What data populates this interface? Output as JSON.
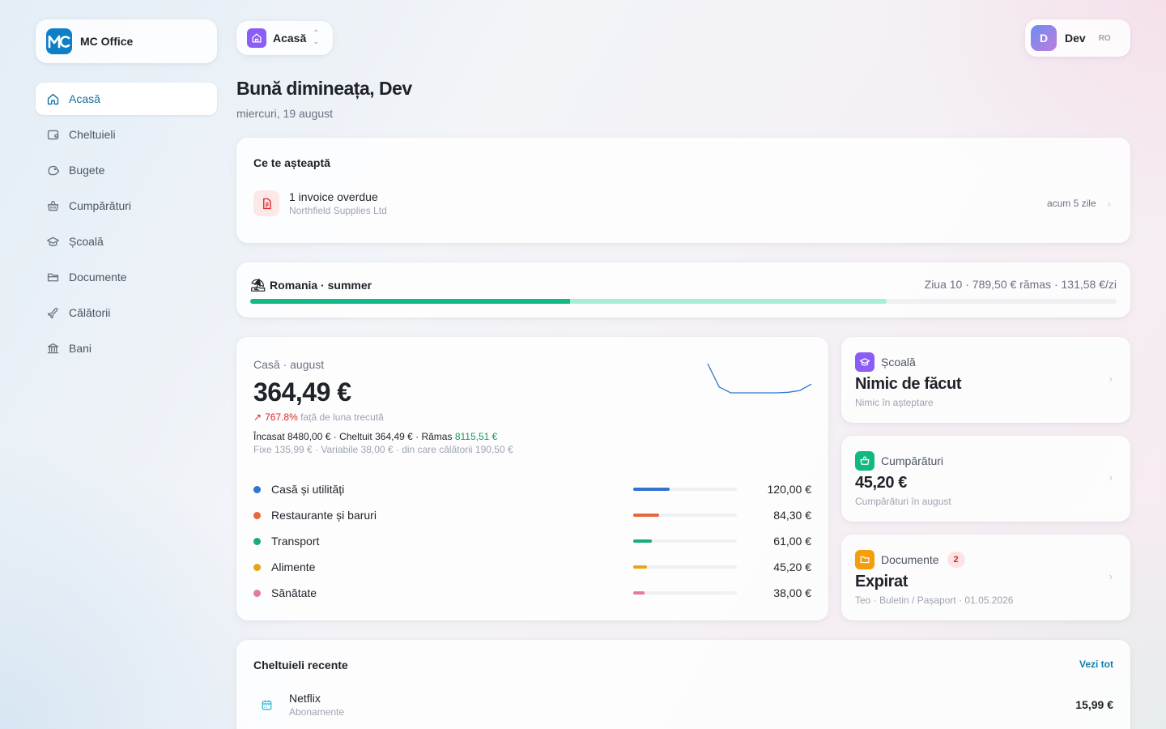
{
  "brand": {
    "name": "MC Office",
    "logo_text": "MC"
  },
  "sidebar": {
    "items": [
      {
        "label": "Acasă",
        "icon": "home-icon",
        "active": true
      },
      {
        "label": "Cheltuieli",
        "icon": "wallet-icon"
      },
      {
        "label": "Bugete",
        "icon": "piggy-bank-icon"
      },
      {
        "label": "Cumpărături",
        "icon": "basket-icon"
      },
      {
        "label": "Școală",
        "icon": "graduation-cap-icon"
      },
      {
        "label": "Documente",
        "icon": "folder-icon"
      },
      {
        "label": "Călătorii",
        "icon": "plane-icon"
      },
      {
        "label": "Bani",
        "icon": "bank-icon"
      }
    ]
  },
  "topbar": {
    "switcher_label": "Acasă",
    "user_initial": "D",
    "user_name": "Dev",
    "language": "RO"
  },
  "header": {
    "greeting": "Bună dimineața, Dev",
    "date": "miercuri, 19 august"
  },
  "awaiting": {
    "title": "Ce te așteaptă",
    "item_title": "1 invoice overdue",
    "item_subtitle": "Northfield Supplies Ltd",
    "item_time": "acum 5 zile"
  },
  "trip": {
    "emoji": "⛱",
    "title": "Romania · summer",
    "info": "Ziua 10 · 789,50 € rămas · 131,58 €/zi",
    "progress_days": 0.369,
    "progress_spent": 0.735
  },
  "home": {
    "label": "Casă · august",
    "amount": "364,49 €",
    "change_arrow": "↗",
    "change_pct": "767.8%",
    "change_text": " față de luna trecută",
    "line1_prefix": "Încasat 8480,00 € · Cheltuit 364,49 € · Rămas ",
    "line1_remaining": "8115,51 €",
    "line2": "Fixe 135,99 € · Variabile 38,00 € · din care călătorii 190,50 €",
    "sparkline": [
      100,
      20,
      0,
      0,
      0,
      0,
      0,
      2,
      8,
      30
    ],
    "categories": [
      {
        "name": "Casă și utilități",
        "value": "120,00 €",
        "share": 0.35,
        "color": "#2f74d0"
      },
      {
        "name": "Restaurante și baruri",
        "value": "84,30 €",
        "share": 0.25,
        "color": "#e8663d"
      },
      {
        "name": "Transport",
        "value": "61,00 €",
        "share": 0.18,
        "color": "#1aab7d"
      },
      {
        "name": "Alimente",
        "value": "45,20 €",
        "share": 0.13,
        "color": "#eaa316"
      },
      {
        "name": "Sănătate",
        "value": "38,00 €",
        "share": 0.11,
        "color": "#e57aa3"
      }
    ]
  },
  "school": {
    "label": "Școală",
    "title": "Nimic de făcut",
    "subtitle": "Nimic în așteptare",
    "color": "#8b5cf6"
  },
  "shopping": {
    "label": "Cumpărături",
    "title": "45,20 €",
    "subtitle": "Cumpărături în august",
    "color": "#10b981"
  },
  "documents": {
    "label": "Documente",
    "badge": "2",
    "title": "Expirat",
    "subtitle": "Teo · Buletin / Pașaport · 01.05.2026",
    "color": "#f59e0b"
  },
  "recent": {
    "title": "Cheltuieli recente",
    "see_all": "Vezi tot",
    "items": [
      {
        "title": "Netflix",
        "subtitle": "Abonamente",
        "value": "15,99 €",
        "icon": "calendar-icon"
      }
    ]
  }
}
